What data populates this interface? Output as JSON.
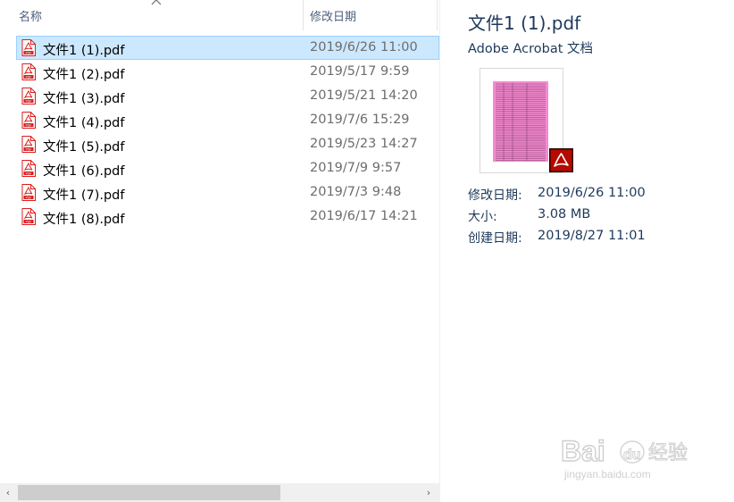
{
  "columns": {
    "name": "名称",
    "date": "修改日期"
  },
  "files": [
    {
      "name": "文件1 (1).pdf",
      "date": "2019/6/26 11:00",
      "selected": true
    },
    {
      "name": "文件1 (2).pdf",
      "date": "2019/5/17 9:59",
      "selected": false
    },
    {
      "name": "文件1 (3).pdf",
      "date": "2019/5/21 14:20",
      "selected": false
    },
    {
      "name": "文件1 (4).pdf",
      "date": "2019/7/6 15:29",
      "selected": false
    },
    {
      "name": "文件1 (5).pdf",
      "date": "2019/5/23 14:27",
      "selected": false
    },
    {
      "name": "文件1 (6).pdf",
      "date": "2019/7/9 9:57",
      "selected": false
    },
    {
      "name": "文件1 (7).pdf",
      "date": "2019/7/3 9:48",
      "selected": false
    },
    {
      "name": "文件1 (8).pdf",
      "date": "2019/6/17 14:21",
      "selected": false
    }
  ],
  "file_icon": "pdf-file-icon",
  "file_icon_label": "PDF",
  "preview": {
    "title": "文件1 (1).pdf",
    "type": "Adobe Acrobat 文档",
    "badge_icon": "adobe-acrobat-icon",
    "meta": [
      {
        "label": "修改日期:",
        "value": "2019/6/26 11:00"
      },
      {
        "label": "大小:",
        "value": "3.08 MB"
      },
      {
        "label": "创建日期:",
        "value": "2019/8/27 11:01"
      }
    ]
  },
  "scrollbar": {
    "left_arrow": "‹",
    "right_arrow": "›"
  },
  "watermark": {
    "brand": "Bai 经验",
    "brand_suffix": "du",
    "url": "jingyan.baidu.com"
  },
  "colors": {
    "selection": "#cce8ff",
    "selection_border": "#99d1ff",
    "pdf_red": "#d71e1e",
    "preview_text": "#1e395b",
    "acrobat_badge": "#b30b00"
  }
}
